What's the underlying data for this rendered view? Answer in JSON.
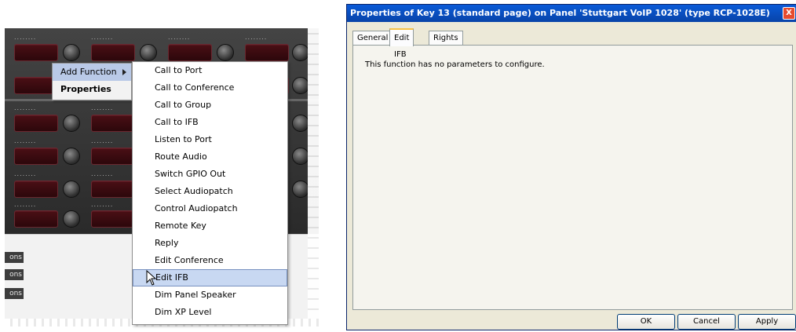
{
  "context_menu": {
    "items": [
      {
        "label": "Add Function",
        "has_submenu": true
      },
      {
        "label": "Properties"
      }
    ]
  },
  "submenu": {
    "items": [
      "Call to Port",
      "Call to Conference",
      "Call to Group",
      "Call to IFB",
      "Listen to Port",
      "Route Audio",
      "Switch GPIO Out",
      "Select Audiopatch",
      "Control Audiopatch",
      "Remote Key",
      "Reply",
      "Edit Conference",
      "Edit IFB",
      "Dim Panel Speaker",
      "Dim XP Level"
    ],
    "selected": "Edit IFB"
  },
  "left_panel": {
    "options_buttons": [
      "ons",
      "ons",
      "ons"
    ],
    "row_dots": "........"
  },
  "dialog": {
    "title": "Properties of Key 13 (standard page) on Panel 'Stuttgart VoIP 1028' (type RCP-1028E)",
    "close_label": "X",
    "tabs": [
      "General",
      "Edit IFB",
      "Rights"
    ],
    "active_tab": "Edit IFB",
    "message": "This function has no parameters to configure.",
    "buttons": {
      "ok": "OK",
      "cancel": "Cancel",
      "apply": "Apply"
    }
  },
  "colors": {
    "title_bar": "#0a5bd8",
    "window_bg": "#ece9d8",
    "selection": "#c8d8f2",
    "key_red": "#4a0f15"
  }
}
